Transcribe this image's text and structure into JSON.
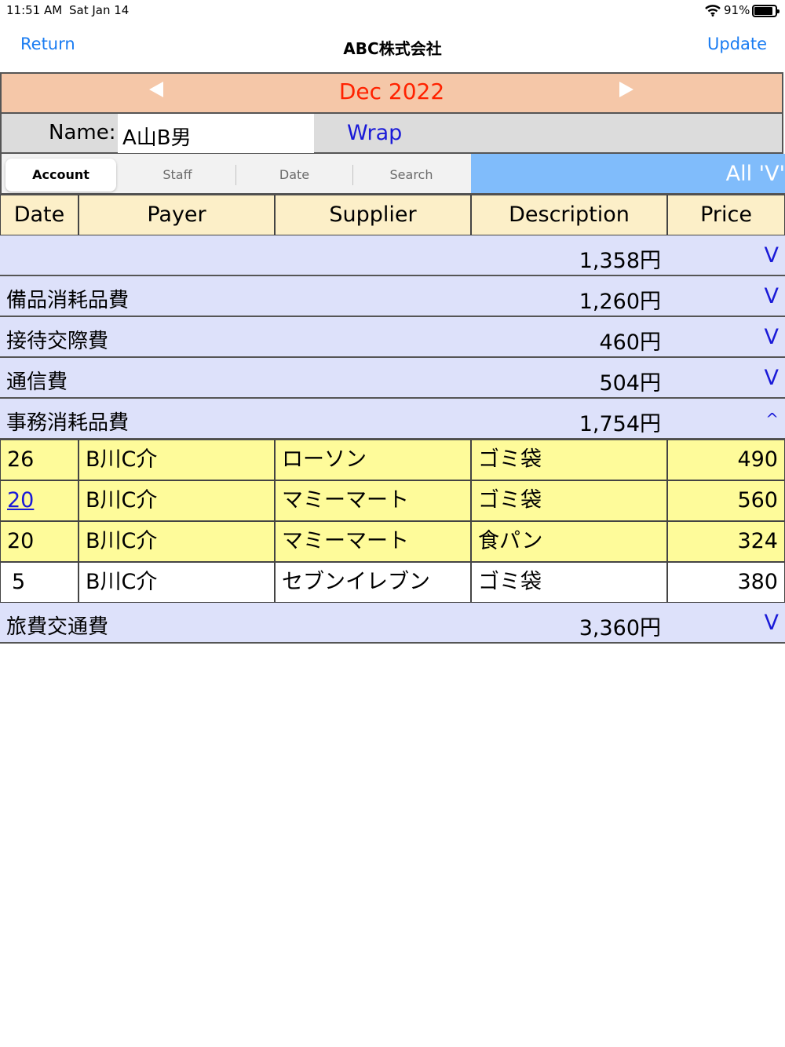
{
  "status_bar": {
    "time": "11:51 AM",
    "date": "Sat Jan 14",
    "battery": "91%"
  },
  "nav": {
    "back_label": "Return",
    "title": "ABC株式会社",
    "update_label": "Update"
  },
  "month": {
    "label": "Dec 2022"
  },
  "name": {
    "label": "Name:",
    "value": "A山B男",
    "wrap_label": "Wrap"
  },
  "segments": {
    "items": [
      "Account",
      "Staff",
      "Date",
      "Search"
    ],
    "selected": "Account"
  },
  "filter": {
    "label": "All 'V'"
  },
  "columns": [
    "Date",
    "Payer",
    "Supplier",
    "Description",
    "Price"
  ],
  "groups": [
    {
      "name": "",
      "amount": "1,358円",
      "toggle": "V"
    },
    {
      "name": "備品消耗品費",
      "amount": "1,260円",
      "toggle": "V"
    },
    {
      "name": "接待交際費",
      "amount": "460円",
      "toggle": "V"
    },
    {
      "name": "通信費",
      "amount": "504円",
      "toggle": "V"
    },
    {
      "name": "事務消耗品費",
      "amount": "1,754円",
      "toggle": "^"
    },
    {
      "name": "旅費交通費",
      "amount": "3,360円",
      "toggle": "V"
    }
  ],
  "details": [
    {
      "date": "26",
      "payer": "B川C介",
      "supplier": "ローソン",
      "description": "ゴミ袋",
      "price": "490"
    },
    {
      "date": "20",
      "payer": "B川C介",
      "supplier": "マミーマート",
      "description": "ゴミ袋",
      "price": "560"
    },
    {
      "date": "20",
      "payer": "B川C介",
      "supplier": "マミーマート",
      "description": "食パン",
      "price": "324"
    },
    {
      "date": "5",
      "payer": "B川C介",
      "supplier": "セブンイレブン",
      "description": "ゴミ袋",
      "price": "380"
    }
  ],
  "colors": {
    "accent": "#1a7cf2",
    "month_bar": "#f5c7a8",
    "month_text": "#ff2200",
    "group_row": "#dde1fa",
    "detail_row": "#fefb9a",
    "header_row": "#fcefc8",
    "filter_bar": "#80bcfb"
  }
}
